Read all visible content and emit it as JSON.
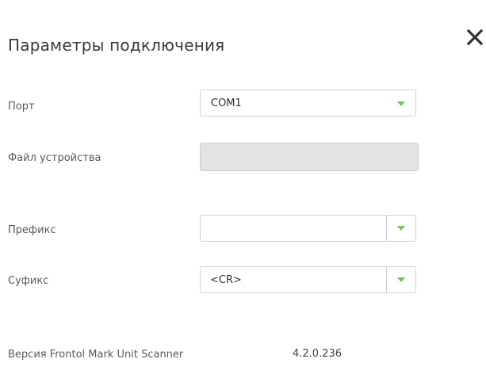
{
  "dialog": {
    "title": "Параметры подключения",
    "close_icon": "close-icon"
  },
  "port": {
    "label": "Порт",
    "value": "COM1",
    "icon": "chevron-down-icon"
  },
  "device_file": {
    "label": "Файл устройства",
    "value": ""
  },
  "prefix": {
    "label": "Префикс",
    "value": "",
    "icon": "chevron-down-icon"
  },
  "suffix": {
    "label": "Суфикс",
    "value": "<CR>",
    "icon": "chevron-down-icon"
  },
  "version": {
    "label": "Версия Frontol Mark Unit Scanner",
    "value": "4.2.0.236"
  },
  "colors": {
    "accent_arrow": "#7cc243",
    "disabled_field": "#e3e3e3"
  }
}
